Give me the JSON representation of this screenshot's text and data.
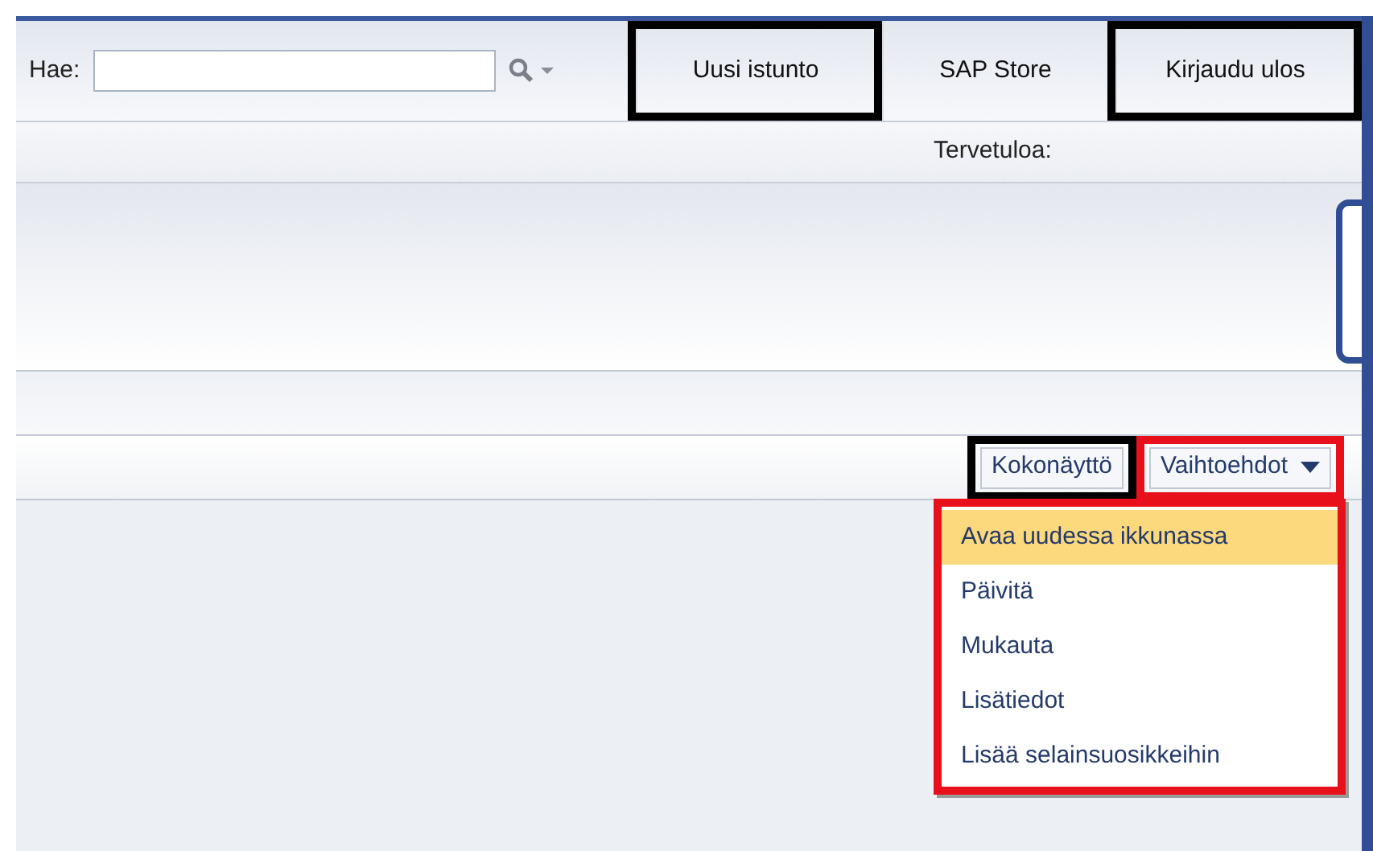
{
  "header": {
    "search_label": "Hae:",
    "buttons": [
      {
        "label": "Uusi istunto",
        "color": "#000000"
      },
      {
        "label": "SAP Store"
      },
      {
        "label": "Kirjaudu ulos",
        "color": "#000000"
      }
    ]
  },
  "welcome": "Tervetuloa:",
  "toolbar": {
    "buttons": [
      {
        "label": "Kokonäyttö",
        "color": "#000000",
        "kind": "plain"
      },
      {
        "label": "Vaihtoehdot",
        "color": "#e8101a",
        "kind": "dropdown"
      }
    ]
  },
  "menu": {
    "color": "#e8101a",
    "items": [
      {
        "label": "Avaa uudessa ikkunassa",
        "selected": true
      },
      {
        "label": "Päivitä",
        "selected": false
      },
      {
        "label": "Mukauta",
        "selected": false
      },
      {
        "label": "Lisätiedot",
        "selected": false
      },
      {
        "label": "Lisää selainsuosikkeihin",
        "selected": false
      }
    ]
  }
}
